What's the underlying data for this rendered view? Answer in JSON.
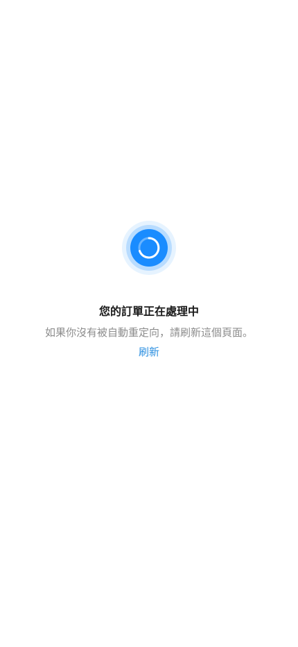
{
  "status": {
    "title": "您的訂單正在處理中",
    "message": "如果你沒有被自動重定向，請刷新這個頁面。",
    "refresh_label": "刷新"
  },
  "colors": {
    "spinner_outer": "#e6f3ff",
    "spinner_mid": "#b8dcff",
    "spinner_core": "#1a8cff",
    "link": "#2b8fe0",
    "text_primary": "#1a1a1a",
    "text_secondary": "#8c8c8c"
  },
  "icons": {
    "loader": "loading-spinner-icon"
  }
}
